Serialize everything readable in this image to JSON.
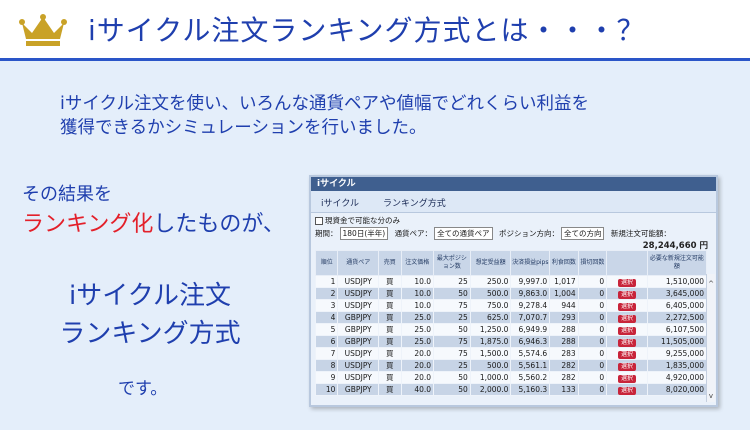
{
  "header": {
    "title": "iサイクル注文ランキング方式とは・・・？",
    "crown_color": "#c9a227"
  },
  "intro": {
    "line1": "iサイクル注文を使い、いろんな通貨ペアや値幅でどれくらい利益を",
    "line2": "獲得できるかシミュレーションを行いました。"
  },
  "result": {
    "line1": "その結果を",
    "highlight": "ランキング化",
    "line2_rest": "したものが、",
    "big1": "iサイクル注文",
    "big2": "ランキング方式",
    "end": "です。"
  },
  "panel": {
    "window_title": "iサイクル",
    "tabs": [
      "iサイクル",
      "ランキング方式"
    ],
    "checkbox_label": "現資金で可能な分のみ",
    "filter_period_label": "期間：",
    "filter_period_value": "180日(半年)",
    "filter_pair_label": "通貨ペア：",
    "filter_pair_value": "全ての通貨ペア",
    "filter_dir_label": "ポジション方向：",
    "filter_dir_value": "全ての方向",
    "available_label": "新規注文可能額：",
    "available_value": "28,244,660 円",
    "columns": [
      "順位",
      "通貨ペア",
      "売買",
      "注文価格",
      "最大ポジション数",
      "想定受益額",
      "決済損益pips",
      "利食回数",
      "損切回数",
      "",
      "必要な新規注文可能額"
    ],
    "select_label": "選択",
    "rows": [
      {
        "rank": "1",
        "pair": "USDJPY",
        "side": "買",
        "width": "10.0",
        "pos": "25",
        "profit": "250.0",
        "pips": "9,997.0",
        "tp": "1,017",
        "sl": "0",
        "need": "1,510,000"
      },
      {
        "rank": "2",
        "pair": "USDJPY",
        "side": "買",
        "width": "10.0",
        "pos": "50",
        "profit": "500.0",
        "pips": "9,863.0",
        "tp": "1,004",
        "sl": "0",
        "need": "3,645,000"
      },
      {
        "rank": "3",
        "pair": "USDJPY",
        "side": "買",
        "width": "10.0",
        "pos": "75",
        "profit": "750.0",
        "pips": "9,278.4",
        "tp": "944",
        "sl": "0",
        "need": "6,405,000"
      },
      {
        "rank": "4",
        "pair": "GBPJPY",
        "side": "買",
        "width": "25.0",
        "pos": "25",
        "profit": "625.0",
        "pips": "7,070.7",
        "tp": "293",
        "sl": "0",
        "need": "2,272,500"
      },
      {
        "rank": "5",
        "pair": "GBPJPY",
        "side": "買",
        "width": "25.0",
        "pos": "50",
        "profit": "1,250.0",
        "pips": "6,949.9",
        "tp": "288",
        "sl": "0",
        "need": "6,107,500"
      },
      {
        "rank": "6",
        "pair": "GBPJPY",
        "side": "買",
        "width": "25.0",
        "pos": "75",
        "profit": "1,875.0",
        "pips": "6,946.3",
        "tp": "288",
        "sl": "0",
        "need": "11,505,000"
      },
      {
        "rank": "7",
        "pair": "USDJPY",
        "side": "買",
        "width": "20.0",
        "pos": "75",
        "profit": "1,500.0",
        "pips": "5,574.6",
        "tp": "283",
        "sl": "0",
        "need": "9,255,000"
      },
      {
        "rank": "8",
        "pair": "USDJPY",
        "side": "買",
        "width": "20.0",
        "pos": "25",
        "profit": "500.0",
        "pips": "5,561.1",
        "tp": "282",
        "sl": "0",
        "need": "1,835,000"
      },
      {
        "rank": "9",
        "pair": "USDJPY",
        "side": "買",
        "width": "20.0",
        "pos": "50",
        "profit": "1,000.0",
        "pips": "5,560.2",
        "tp": "282",
        "sl": "0",
        "need": "4,920,000"
      },
      {
        "rank": "10",
        "pair": "GBPJPY",
        "side": "買",
        "width": "40.0",
        "pos": "50",
        "profit": "2,000.0",
        "pips": "5,160.3",
        "tp": "133",
        "sl": "0",
        "need": "8,020,000"
      }
    ]
  }
}
